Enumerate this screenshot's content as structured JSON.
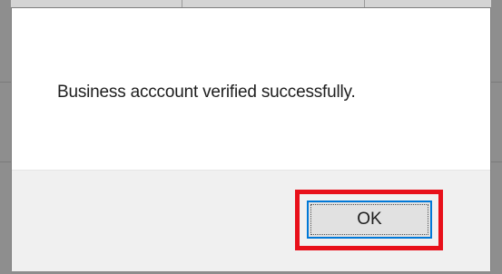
{
  "dialog": {
    "message": "Business acccount verified successfully.",
    "ok_label": "OK"
  },
  "colors": {
    "highlight": "#e8101a",
    "button_border": "#0078d7",
    "button_face": "#e1e1e1",
    "footer": "#f0f0f0"
  }
}
